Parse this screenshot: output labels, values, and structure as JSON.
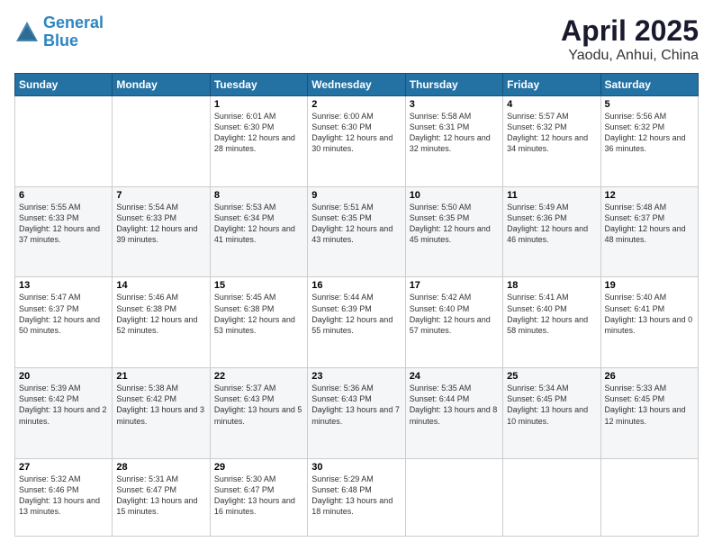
{
  "header": {
    "logo_line1": "General",
    "logo_line2": "Blue",
    "title": "April 2025",
    "subtitle": "Yaodu, Anhui, China"
  },
  "days_of_week": [
    "Sunday",
    "Monday",
    "Tuesday",
    "Wednesday",
    "Thursday",
    "Friday",
    "Saturday"
  ],
  "weeks": [
    [
      {
        "day": "",
        "sunrise": "",
        "sunset": "",
        "daylight": ""
      },
      {
        "day": "",
        "sunrise": "",
        "sunset": "",
        "daylight": ""
      },
      {
        "day": "1",
        "sunrise": "Sunrise: 6:01 AM",
        "sunset": "Sunset: 6:30 PM",
        "daylight": "Daylight: 12 hours and 28 minutes."
      },
      {
        "day": "2",
        "sunrise": "Sunrise: 6:00 AM",
        "sunset": "Sunset: 6:30 PM",
        "daylight": "Daylight: 12 hours and 30 minutes."
      },
      {
        "day": "3",
        "sunrise": "Sunrise: 5:58 AM",
        "sunset": "Sunset: 6:31 PM",
        "daylight": "Daylight: 12 hours and 32 minutes."
      },
      {
        "day": "4",
        "sunrise": "Sunrise: 5:57 AM",
        "sunset": "Sunset: 6:32 PM",
        "daylight": "Daylight: 12 hours and 34 minutes."
      },
      {
        "day": "5",
        "sunrise": "Sunrise: 5:56 AM",
        "sunset": "Sunset: 6:32 PM",
        "daylight": "Daylight: 12 hours and 36 minutes."
      }
    ],
    [
      {
        "day": "6",
        "sunrise": "Sunrise: 5:55 AM",
        "sunset": "Sunset: 6:33 PM",
        "daylight": "Daylight: 12 hours and 37 minutes."
      },
      {
        "day": "7",
        "sunrise": "Sunrise: 5:54 AM",
        "sunset": "Sunset: 6:33 PM",
        "daylight": "Daylight: 12 hours and 39 minutes."
      },
      {
        "day": "8",
        "sunrise": "Sunrise: 5:53 AM",
        "sunset": "Sunset: 6:34 PM",
        "daylight": "Daylight: 12 hours and 41 minutes."
      },
      {
        "day": "9",
        "sunrise": "Sunrise: 5:51 AM",
        "sunset": "Sunset: 6:35 PM",
        "daylight": "Daylight: 12 hours and 43 minutes."
      },
      {
        "day": "10",
        "sunrise": "Sunrise: 5:50 AM",
        "sunset": "Sunset: 6:35 PM",
        "daylight": "Daylight: 12 hours and 45 minutes."
      },
      {
        "day": "11",
        "sunrise": "Sunrise: 5:49 AM",
        "sunset": "Sunset: 6:36 PM",
        "daylight": "Daylight: 12 hours and 46 minutes."
      },
      {
        "day": "12",
        "sunrise": "Sunrise: 5:48 AM",
        "sunset": "Sunset: 6:37 PM",
        "daylight": "Daylight: 12 hours and 48 minutes."
      }
    ],
    [
      {
        "day": "13",
        "sunrise": "Sunrise: 5:47 AM",
        "sunset": "Sunset: 6:37 PM",
        "daylight": "Daylight: 12 hours and 50 minutes."
      },
      {
        "day": "14",
        "sunrise": "Sunrise: 5:46 AM",
        "sunset": "Sunset: 6:38 PM",
        "daylight": "Daylight: 12 hours and 52 minutes."
      },
      {
        "day": "15",
        "sunrise": "Sunrise: 5:45 AM",
        "sunset": "Sunset: 6:38 PM",
        "daylight": "Daylight: 12 hours and 53 minutes."
      },
      {
        "day": "16",
        "sunrise": "Sunrise: 5:44 AM",
        "sunset": "Sunset: 6:39 PM",
        "daylight": "Daylight: 12 hours and 55 minutes."
      },
      {
        "day": "17",
        "sunrise": "Sunrise: 5:42 AM",
        "sunset": "Sunset: 6:40 PM",
        "daylight": "Daylight: 12 hours and 57 minutes."
      },
      {
        "day": "18",
        "sunrise": "Sunrise: 5:41 AM",
        "sunset": "Sunset: 6:40 PM",
        "daylight": "Daylight: 12 hours and 58 minutes."
      },
      {
        "day": "19",
        "sunrise": "Sunrise: 5:40 AM",
        "sunset": "Sunset: 6:41 PM",
        "daylight": "Daylight: 13 hours and 0 minutes."
      }
    ],
    [
      {
        "day": "20",
        "sunrise": "Sunrise: 5:39 AM",
        "sunset": "Sunset: 6:42 PM",
        "daylight": "Daylight: 13 hours and 2 minutes."
      },
      {
        "day": "21",
        "sunrise": "Sunrise: 5:38 AM",
        "sunset": "Sunset: 6:42 PM",
        "daylight": "Daylight: 13 hours and 3 minutes."
      },
      {
        "day": "22",
        "sunrise": "Sunrise: 5:37 AM",
        "sunset": "Sunset: 6:43 PM",
        "daylight": "Daylight: 13 hours and 5 minutes."
      },
      {
        "day": "23",
        "sunrise": "Sunrise: 5:36 AM",
        "sunset": "Sunset: 6:43 PM",
        "daylight": "Daylight: 13 hours and 7 minutes."
      },
      {
        "day": "24",
        "sunrise": "Sunrise: 5:35 AM",
        "sunset": "Sunset: 6:44 PM",
        "daylight": "Daylight: 13 hours and 8 minutes."
      },
      {
        "day": "25",
        "sunrise": "Sunrise: 5:34 AM",
        "sunset": "Sunset: 6:45 PM",
        "daylight": "Daylight: 13 hours and 10 minutes."
      },
      {
        "day": "26",
        "sunrise": "Sunrise: 5:33 AM",
        "sunset": "Sunset: 6:45 PM",
        "daylight": "Daylight: 13 hours and 12 minutes."
      }
    ],
    [
      {
        "day": "27",
        "sunrise": "Sunrise: 5:32 AM",
        "sunset": "Sunset: 6:46 PM",
        "daylight": "Daylight: 13 hours and 13 minutes."
      },
      {
        "day": "28",
        "sunrise": "Sunrise: 5:31 AM",
        "sunset": "Sunset: 6:47 PM",
        "daylight": "Daylight: 13 hours and 15 minutes."
      },
      {
        "day": "29",
        "sunrise": "Sunrise: 5:30 AM",
        "sunset": "Sunset: 6:47 PM",
        "daylight": "Daylight: 13 hours and 16 minutes."
      },
      {
        "day": "30",
        "sunrise": "Sunrise: 5:29 AM",
        "sunset": "Sunset: 6:48 PM",
        "daylight": "Daylight: 13 hours and 18 minutes."
      },
      {
        "day": "",
        "sunrise": "",
        "sunset": "",
        "daylight": ""
      },
      {
        "day": "",
        "sunrise": "",
        "sunset": "",
        "daylight": ""
      },
      {
        "day": "",
        "sunrise": "",
        "sunset": "",
        "daylight": ""
      }
    ]
  ]
}
